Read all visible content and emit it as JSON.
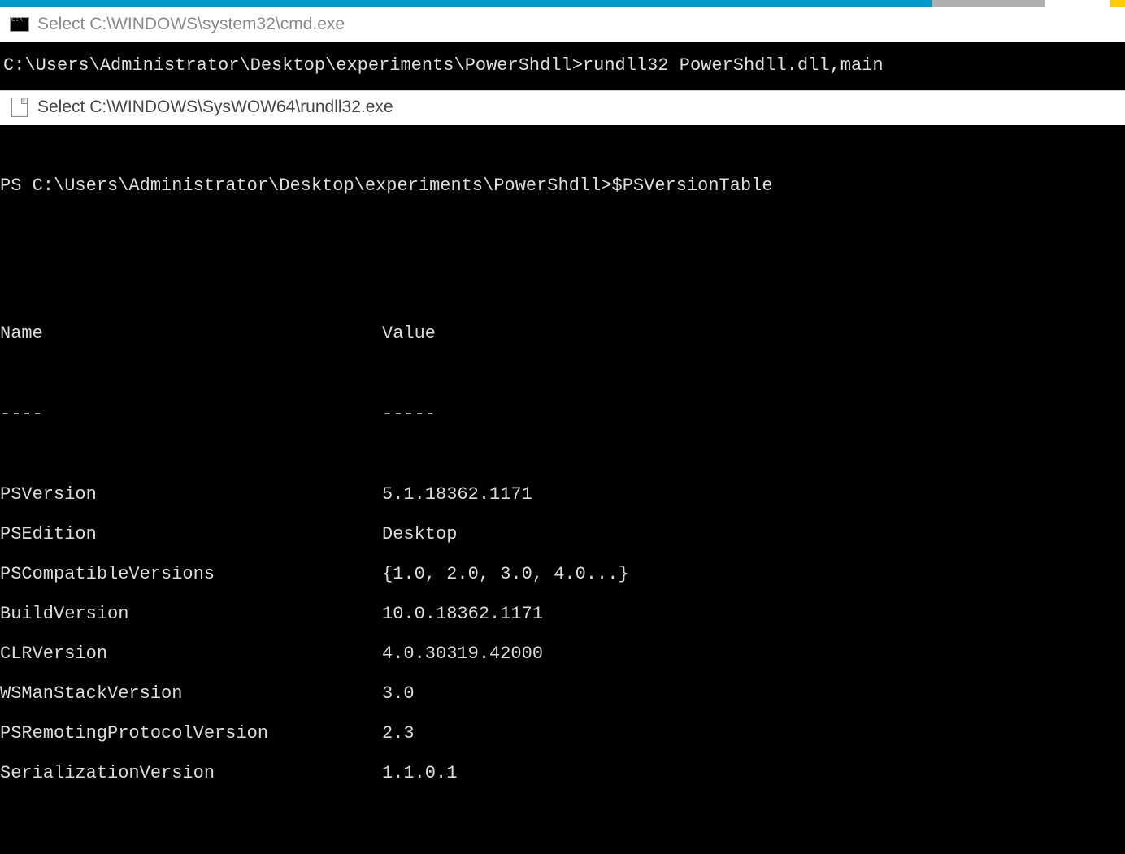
{
  "window1": {
    "title": "Select C:\\WINDOWS\\system32\\cmd.exe",
    "prompt": "C:\\Users\\Administrator\\Desktop\\experiments\\PowerShdll>",
    "command": "rundll32 PowerShdll.dll,main"
  },
  "window2": {
    "title": "Select C:\\WINDOWS\\SysWOW64\\rundll32.exe",
    "prompt": "PS C:\\Users\\Administrator\\Desktop\\experiments\\PowerShdll>",
    "command": "$PSVersionTable",
    "headers": {
      "name": "Name",
      "value": "Value"
    },
    "separators": {
      "name": "----",
      "value": "-----"
    },
    "rows": [
      {
        "name": "PSVersion",
        "value": "5.1.18362.1171"
      },
      {
        "name": "PSEdition",
        "value": "Desktop"
      },
      {
        "name": "PSCompatibleVersions",
        "value": "{1.0, 2.0, 3.0, 4.0...}"
      },
      {
        "name": "BuildVersion",
        "value": "10.0.18362.1171"
      },
      {
        "name": "CLRVersion",
        "value": "4.0.30319.42000"
      },
      {
        "name": "WSManStackVersion",
        "value": "3.0"
      },
      {
        "name": "PSRemotingProtocolVersion",
        "value": "2.3"
      },
      {
        "name": "SerializationVersion",
        "value": "1.1.0.1"
      }
    ]
  }
}
